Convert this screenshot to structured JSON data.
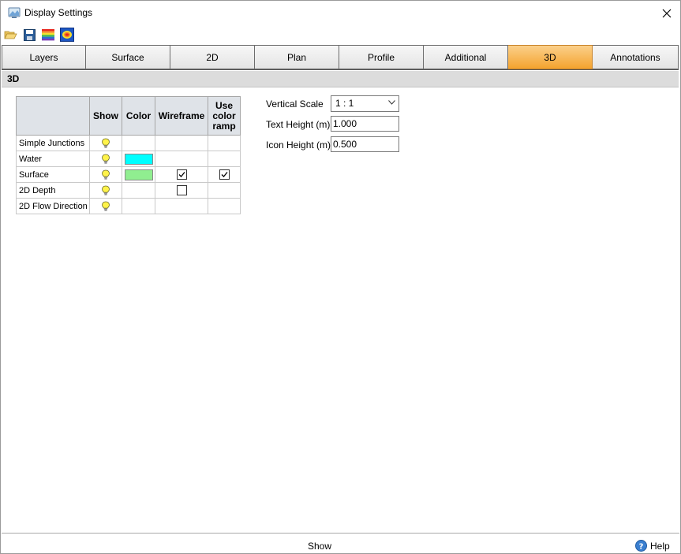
{
  "window": {
    "title": "Display Settings"
  },
  "toolbar": {
    "icons": [
      "open-folder-icon",
      "save-icon",
      "color-ramp-icon",
      "render-settings-icon"
    ]
  },
  "tabs": [
    {
      "label": "Layers",
      "active": false
    },
    {
      "label": "Surface",
      "active": false
    },
    {
      "label": "2D",
      "active": false
    },
    {
      "label": "Plan",
      "active": false
    },
    {
      "label": "Profile",
      "active": false
    },
    {
      "label": "Additional",
      "active": false
    },
    {
      "label": "3D",
      "active": true
    },
    {
      "label": "Annotations",
      "active": false
    }
  ],
  "section": {
    "title": "3D"
  },
  "layers_table": {
    "headers": {
      "show": "Show",
      "color": "Color",
      "wireframe": "Wireframe",
      "ramp_line1": "Use",
      "ramp_line2": "color",
      "ramp_line3": "ramp"
    },
    "rows": [
      {
        "name": "Simple Junctions",
        "show": true,
        "color": null,
        "wireframe": null,
        "ramp": null
      },
      {
        "name": "Water",
        "show": true,
        "color": "#00ffff",
        "wireframe": null,
        "ramp": null
      },
      {
        "name": "Surface",
        "show": true,
        "color": "#90ee90",
        "wireframe": true,
        "ramp": true
      },
      {
        "name": "2D Depth",
        "show": true,
        "color": null,
        "wireframe": false,
        "ramp": null
      },
      {
        "name": "2D Flow Direction",
        "show": true,
        "color": null,
        "wireframe": null,
        "ramp": null
      }
    ]
  },
  "form": {
    "vertical_scale_label": "Vertical Scale",
    "vertical_scale_value": "1 : 1",
    "text_height_label": "Text Height (m)",
    "text_height_value": "1.000",
    "icon_height_label": "Icon Height (m)",
    "icon_height_value": "0.500"
  },
  "statusbar": {
    "text": "Show",
    "help_label": "Help"
  },
  "colors": {
    "active_tab": "#f4a32e",
    "header_bg": "#dcdcdc"
  }
}
